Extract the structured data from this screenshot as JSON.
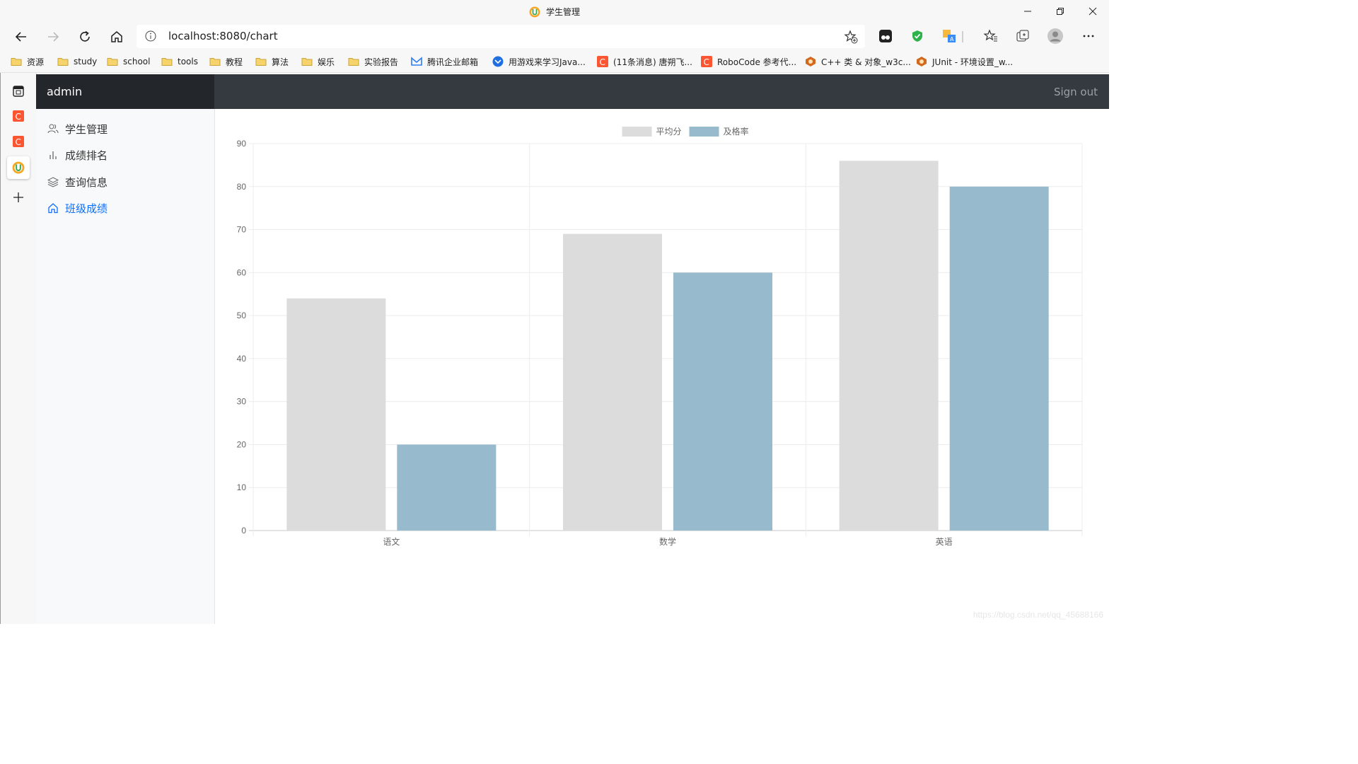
{
  "browser": {
    "window_title": "学生管理",
    "url": "localhost:8080/chart",
    "bookmarks": [
      {
        "label": "资源",
        "icon": "folder-icon"
      },
      {
        "label": "study",
        "icon": "folder-icon"
      },
      {
        "label": "school",
        "icon": "folder-icon"
      },
      {
        "label": "tools",
        "icon": "folder-icon"
      },
      {
        "label": "教程",
        "icon": "folder-icon"
      },
      {
        "label": "算法",
        "icon": "folder-icon"
      },
      {
        "label": "娱乐",
        "icon": "folder-icon"
      },
      {
        "label": "实验报告",
        "icon": "folder-icon"
      },
      {
        "label": "腾讯企业邮箱",
        "icon": "tencent-mail-icon"
      },
      {
        "label": "用游戏来学习Java...",
        "icon": "site-icon"
      },
      {
        "label": "(11条消息) 唐朔飞...",
        "icon": "csdn-icon"
      },
      {
        "label": "RoboCode 参考代...",
        "icon": "csdn-icon"
      },
      {
        "label": "C++ 类 & 对象_w3c...",
        "icon": "w3c-icon"
      },
      {
        "label": "JUnit - 环境设置_w...",
        "icon": "w3c-icon"
      }
    ]
  },
  "app": {
    "brand": "admin",
    "signout_label": "Sign out",
    "nav": [
      {
        "label": "学生管理",
        "icon": "users-icon",
        "active": false
      },
      {
        "label": "成绩排名",
        "icon": "bar-chart-icon",
        "active": false
      },
      {
        "label": "查询信息",
        "icon": "layers-icon",
        "active": false
      },
      {
        "label": "班级成绩",
        "icon": "home-icon",
        "active": true
      }
    ]
  },
  "chart_data": {
    "type": "bar",
    "categories": [
      "语文",
      "数学",
      "英语"
    ],
    "series": [
      {
        "name": "平均分",
        "values": [
          54,
          69,
          86
        ],
        "color": "#dcdcdc"
      },
      {
        "name": "及格率",
        "values": [
          20,
          60,
          80
        ],
        "color": "#97bbcd"
      }
    ],
    "ylim": [
      0,
      90
    ],
    "yticks": [
      0,
      10,
      20,
      30,
      40,
      50,
      60,
      70,
      80,
      90
    ],
    "grid": true,
    "legend_position": "top-center"
  },
  "watermark": "https://blog.csdn.net/qq_45688166"
}
